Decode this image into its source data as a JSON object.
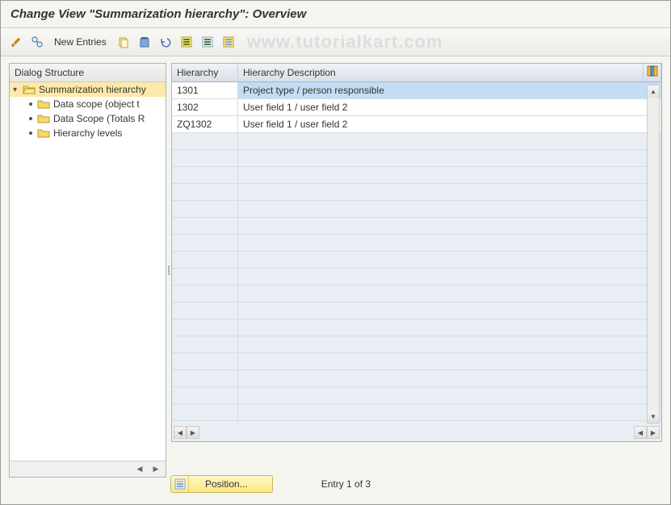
{
  "title": "Change View \"Summarization hierarchy\": Overview",
  "toolbar": {
    "new_entries_label": "New Entries"
  },
  "watermark": "www.tutorialkart.com",
  "dialog_structure": {
    "header": "Dialog Structure",
    "root": "Summarization hierarchy",
    "children": [
      "Data scope (object t",
      "Data Scope (Totals R",
      "Hierarchy levels"
    ]
  },
  "table": {
    "col_hierarchy": "Hierarchy",
    "col_description": "Hierarchy Description",
    "rows": [
      {
        "h": "1301",
        "d": "Project type / person responsible",
        "selected": true
      },
      {
        "h": "1302",
        "d": "User field 1 / user field 2",
        "selected": false
      },
      {
        "h": "ZQ1302",
        "d": "User field 1 / user field 2",
        "selected": false
      }
    ]
  },
  "footer": {
    "position_label": "Position...",
    "entry_text": "Entry 1 of 3"
  }
}
